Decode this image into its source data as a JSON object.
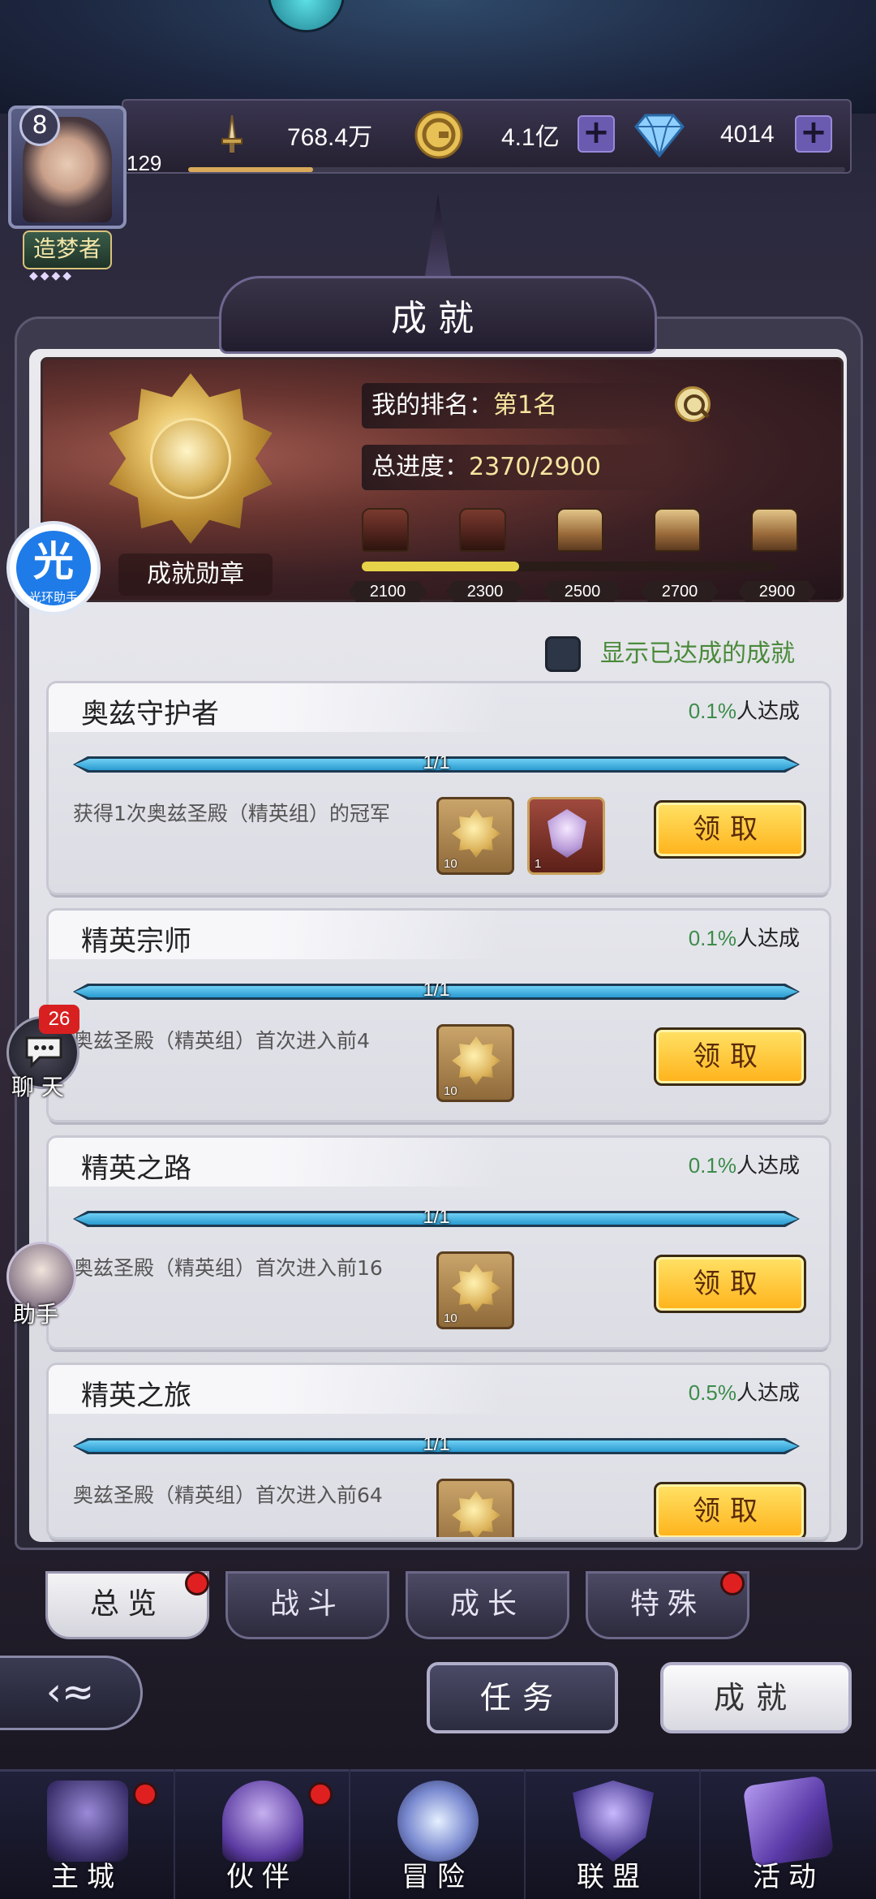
{
  "player": {
    "level": "8",
    "id_number": "129",
    "title": "造梦者",
    "title_stars": "◆◆◆◆",
    "xp_fraction": 0.19
  },
  "resources": {
    "power": "768.4万",
    "gold": "4.1亿",
    "diamonds": "4014",
    "plus_label": "+"
  },
  "panel": {
    "title": "成就"
  },
  "summary": {
    "medal_label": "成就勋章",
    "rank_label": "我的排名：",
    "rank_value": "第1名",
    "progress_label": "总进度：",
    "progress_value": "2370/2900",
    "milestones": [
      "2100",
      "2300",
      "2500",
      "2700",
      "2900"
    ],
    "milestone_progress_fraction": 0.38
  },
  "filter": {
    "label": "显示已达成的成就",
    "checked": false
  },
  "achievements": [
    {
      "title": "奥兹守护者",
      "percent": "0.1%",
      "percent_suffix": "人达成",
      "progress_text": "1/1",
      "progress_fraction": 1.0,
      "description": "获得1次奥兹圣殿（精英组）的冠军",
      "rewards": [
        {
          "kind": "medal",
          "qty": "10"
        },
        {
          "kind": "emblem",
          "qty": "1"
        }
      ],
      "claim_label": "领取"
    },
    {
      "title": "精英宗师",
      "percent": "0.1%",
      "percent_suffix": "人达成",
      "progress_text": "1/1",
      "progress_fraction": 1.0,
      "description": "奥兹圣殿（精英组）首次进入前4",
      "rewards": [
        {
          "kind": "medal",
          "qty": "10"
        }
      ],
      "claim_label": "领取"
    },
    {
      "title": "精英之路",
      "percent": "0.1%",
      "percent_suffix": "人达成",
      "progress_text": "1/1",
      "progress_fraction": 1.0,
      "description": "奥兹圣殿（精英组）首次进入前16",
      "rewards": [
        {
          "kind": "medal",
          "qty": "10"
        }
      ],
      "claim_label": "领取"
    },
    {
      "title": "精英之旅",
      "percent": "0.5%",
      "percent_suffix": "人达成",
      "progress_text": "1/1",
      "progress_fraction": 1.0,
      "description": "奥兹圣殿（精英组）首次进入前64",
      "rewards": [
        {
          "kind": "medal",
          "qty": "10"
        }
      ],
      "claim_label": "领取"
    }
  ],
  "sub_tabs": [
    {
      "label": "总览",
      "active": true,
      "badge": true
    },
    {
      "label": "战斗",
      "active": false,
      "badge": false
    },
    {
      "label": "成长",
      "active": false,
      "badge": false
    },
    {
      "label": "特殊",
      "active": false,
      "badge": true
    }
  ],
  "actions": {
    "back_glyph": "‹≈",
    "tasks_label": "任务",
    "achievements_label": "成就"
  },
  "side": {
    "halo_assistant_glyph": "光",
    "halo_assistant_label": "光环助手",
    "chat_badge": "26",
    "chat_label": "聊 天",
    "helper_label": "助手"
  },
  "bottom_nav": [
    {
      "label": "主城",
      "icon": "castle-icon",
      "badge": true
    },
    {
      "label": "伙伴",
      "icon": "wizard-hat-icon",
      "badge": true
    },
    {
      "label": "冒险",
      "icon": "compass-icon",
      "badge": false
    },
    {
      "label": "联盟",
      "icon": "shield-icon",
      "badge": false
    },
    {
      "label": "活动",
      "icon": "cards-icon",
      "badge": false
    }
  ],
  "colors": {
    "accent_green": "#3d8c4a",
    "progress_blue": "#2a9ad0",
    "claim_yellow": "#ffb21a",
    "badge_red": "#e02020"
  }
}
